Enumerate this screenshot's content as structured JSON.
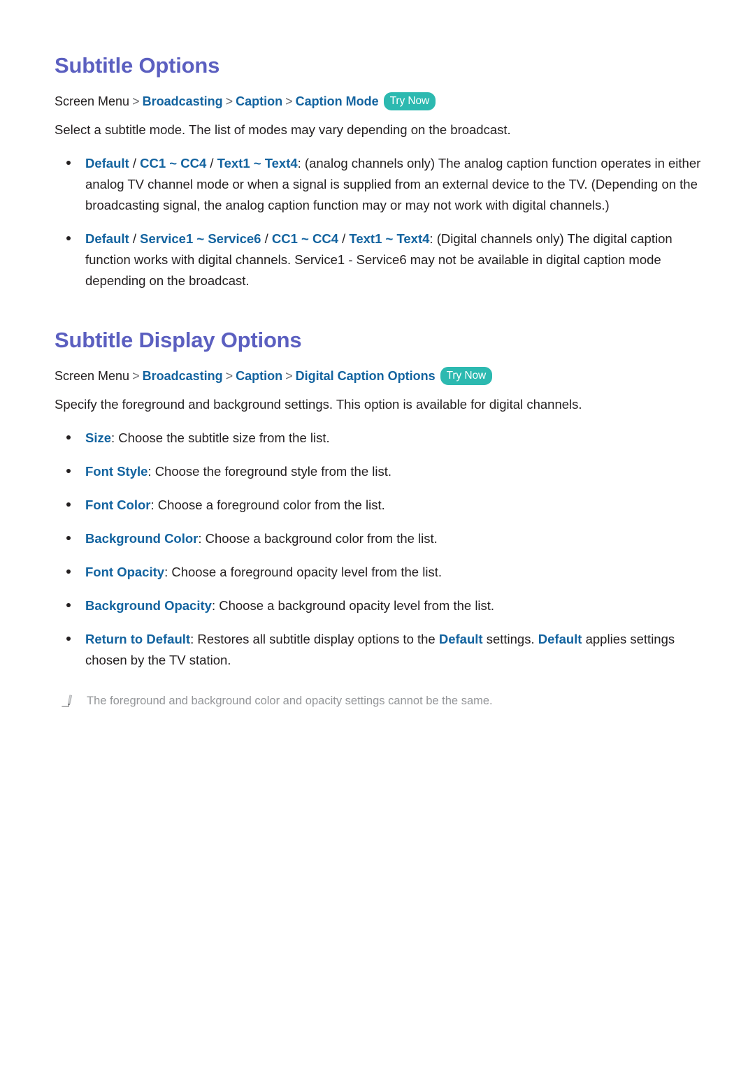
{
  "colors": {
    "heading": "#5b5fc0",
    "link": "#13639f",
    "body": "#231f20",
    "badge_bg": "#2cb9b0",
    "badge_text": "#ffffff",
    "note_text": "#939598",
    "separator": "#6d6e71"
  },
  "sections": [
    {
      "title": "Subtitle Options",
      "breadcrumb": {
        "root": "Screen Menu",
        "separator": ">",
        "links": [
          "Broadcasting",
          "Caption",
          "Caption Mode"
        ],
        "badge": "Try Now"
      },
      "intro": "Select a subtitle mode. The list of modes may vary depending on the broadcast.",
      "bullets": [
        {
          "terms": [
            "Default",
            "CC1 ~ CC4",
            "Text1 ~ Text4"
          ],
          "separator": "/",
          "text": ": (analog channels only) The analog caption function operates in either analog TV channel mode or when a signal is supplied from an external device to the TV. (Depending on the broadcasting signal, the analog caption function may or may not work with digital channels.)"
        },
        {
          "terms": [
            "Default",
            "Service1 ~ Service6",
            "CC1 ~ CC4",
            "Text1 ~ Text4"
          ],
          "separator": "/",
          "text": ": (Digital channels only) The digital caption function works with digital channels. Service1 - Service6 may not be available in digital caption mode depending on the broadcast."
        }
      ]
    },
    {
      "title": "Subtitle Display Options",
      "breadcrumb": {
        "root": "Screen Menu",
        "separator": ">",
        "links": [
          "Broadcasting",
          "Caption",
          "Digital Caption Options"
        ],
        "badge": "Try Now"
      },
      "intro": "Specify the foreground and background settings. This option is available for digital channels.",
      "bullets": [
        {
          "term": "Size",
          "text": ": Choose the subtitle size from the list."
        },
        {
          "term": "Font Style",
          "text": ": Choose the foreground style from the list."
        },
        {
          "term": "Font Color",
          "text": ": Choose a foreground color from the list."
        },
        {
          "term": "Background Color",
          "text": ": Choose a background color from the list."
        },
        {
          "term": "Font Opacity",
          "text": ": Choose a foreground opacity level from the list."
        },
        {
          "term": "Background Opacity",
          "text": ": Choose a background opacity level from the list."
        },
        {
          "term": "Return to Default",
          "text_parts": [
            {
              "type": "plain",
              "value": ": Restores all subtitle display options to the "
            },
            {
              "type": "link",
              "value": "Default"
            },
            {
              "type": "plain",
              "value": " settings. "
            },
            {
              "type": "link",
              "value": "Default"
            },
            {
              "type": "plain",
              "value": " applies settings chosen by the TV station."
            }
          ]
        }
      ],
      "note": {
        "icon": "pencil-icon",
        "text": "The foreground and background color and opacity settings cannot be the same."
      }
    }
  ]
}
